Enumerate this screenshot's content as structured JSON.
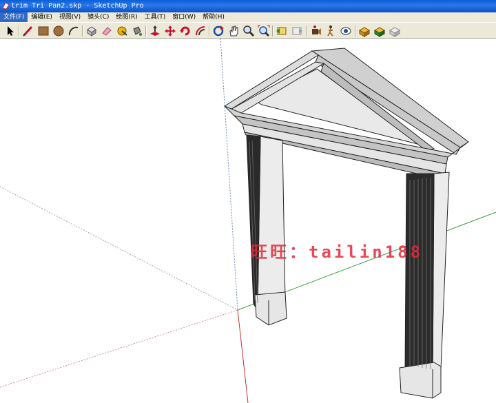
{
  "window": {
    "title": "trim Tri Pan2.skp - SketchUp Pro"
  },
  "menu": {
    "items": [
      {
        "label": "文件(F)"
      },
      {
        "label": "编辑(E)"
      },
      {
        "label": "视图(V)"
      },
      {
        "label": "镜头(C)"
      },
      {
        "label": "绘图(R)"
      },
      {
        "label": "工具(T)"
      },
      {
        "label": "窗口(W)"
      },
      {
        "label": "帮助(H)"
      }
    ]
  },
  "toolbar": {
    "tools": [
      "select-icon",
      "pencil-icon",
      "rectangle-icon",
      "circle-icon",
      "arc-icon",
      "make-component-icon",
      "eraser-icon",
      "tape-measure-icon",
      "paint-bucket-icon",
      "push-pull-icon",
      "move-icon",
      "rotate-icon",
      "offset-icon",
      "orbit-icon",
      "pan-icon",
      "zoom-icon",
      "zoom-extents-icon",
      "previous-view-icon",
      "next-view-icon",
      "position-camera-icon",
      "walk-icon",
      "look-around-icon",
      "get-models-icon",
      "share-model-icon",
      "component-warehouse-icon"
    ]
  },
  "viewport": {
    "watermark": "旺旺：tailin188"
  }
}
